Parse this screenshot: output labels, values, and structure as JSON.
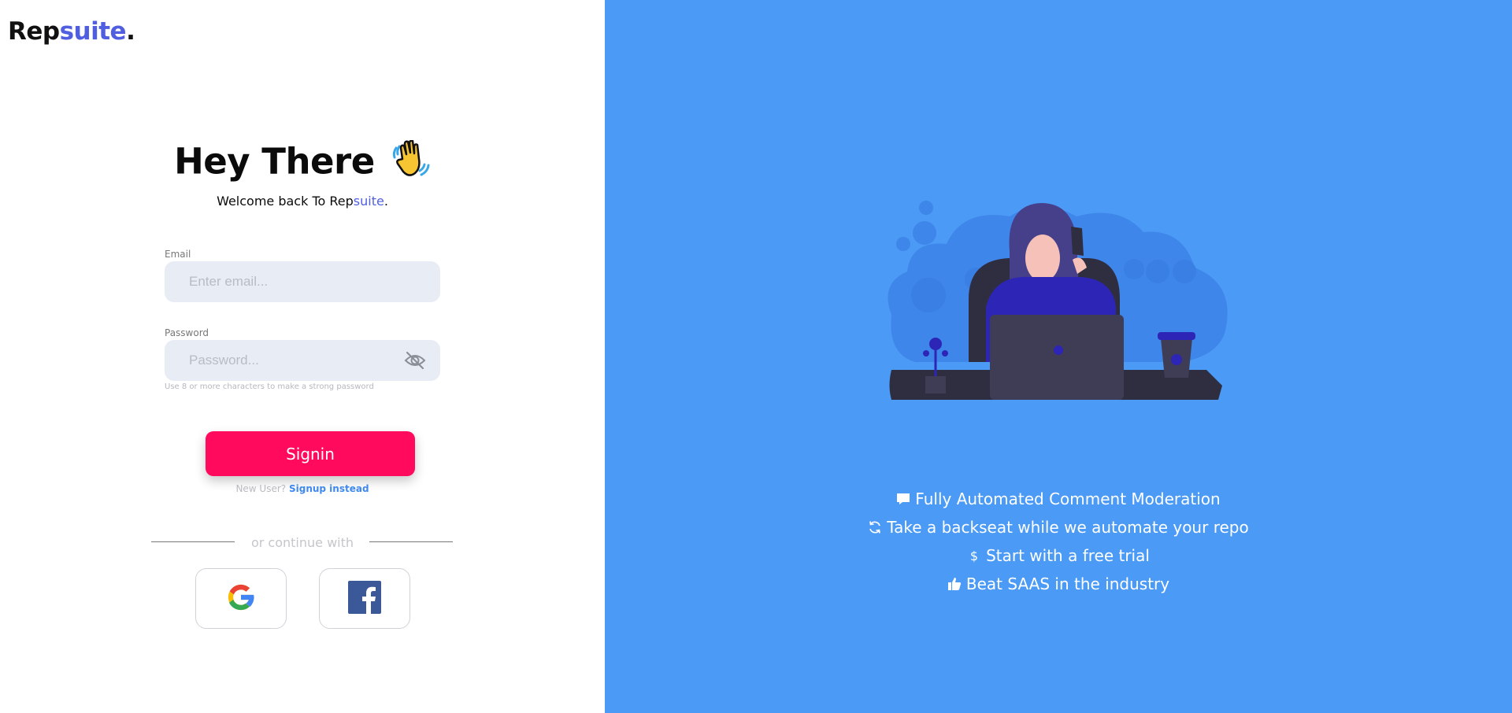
{
  "brand": {
    "name_part1": "Rep",
    "name_part2": "suite",
    "name_dot": "."
  },
  "hero": {
    "title": "Hey There",
    "subtitle_prefix": "Welcome back To Rep",
    "subtitle_accent": "suite",
    "subtitle_suffix": "."
  },
  "form": {
    "email_label": "Email",
    "email_placeholder": "Enter email...",
    "email_value": "",
    "password_label": "Password",
    "password_placeholder": "Password...",
    "password_value": "",
    "password_hint": "Use 8 or more characters to make a strong password",
    "signin_label": "Signin",
    "new_user_text": "New User?",
    "signup_link": "Signup instead",
    "divider_text": "or continue with"
  },
  "social": [
    {
      "provider": "google",
      "icon": "google-icon"
    },
    {
      "provider": "facebook",
      "icon": "facebook-icon"
    }
  ],
  "features": [
    {
      "icon": "comment-icon",
      "text": "Fully Automated Comment Moderation"
    },
    {
      "icon": "refresh-icon",
      "text": "Take a backseat while we automate your repo"
    },
    {
      "icon": "dollar-icon",
      "text": "Start with a free trial"
    },
    {
      "icon": "thumbs-up-icon",
      "text": "Beat SAAS in the industry"
    }
  ],
  "colors": {
    "accent": "#4f5fe0",
    "right_panel": "#4a9af6",
    "signin_button": "#ff0a5c",
    "link": "#3f88ee",
    "input_bg": "#e8edf5"
  }
}
